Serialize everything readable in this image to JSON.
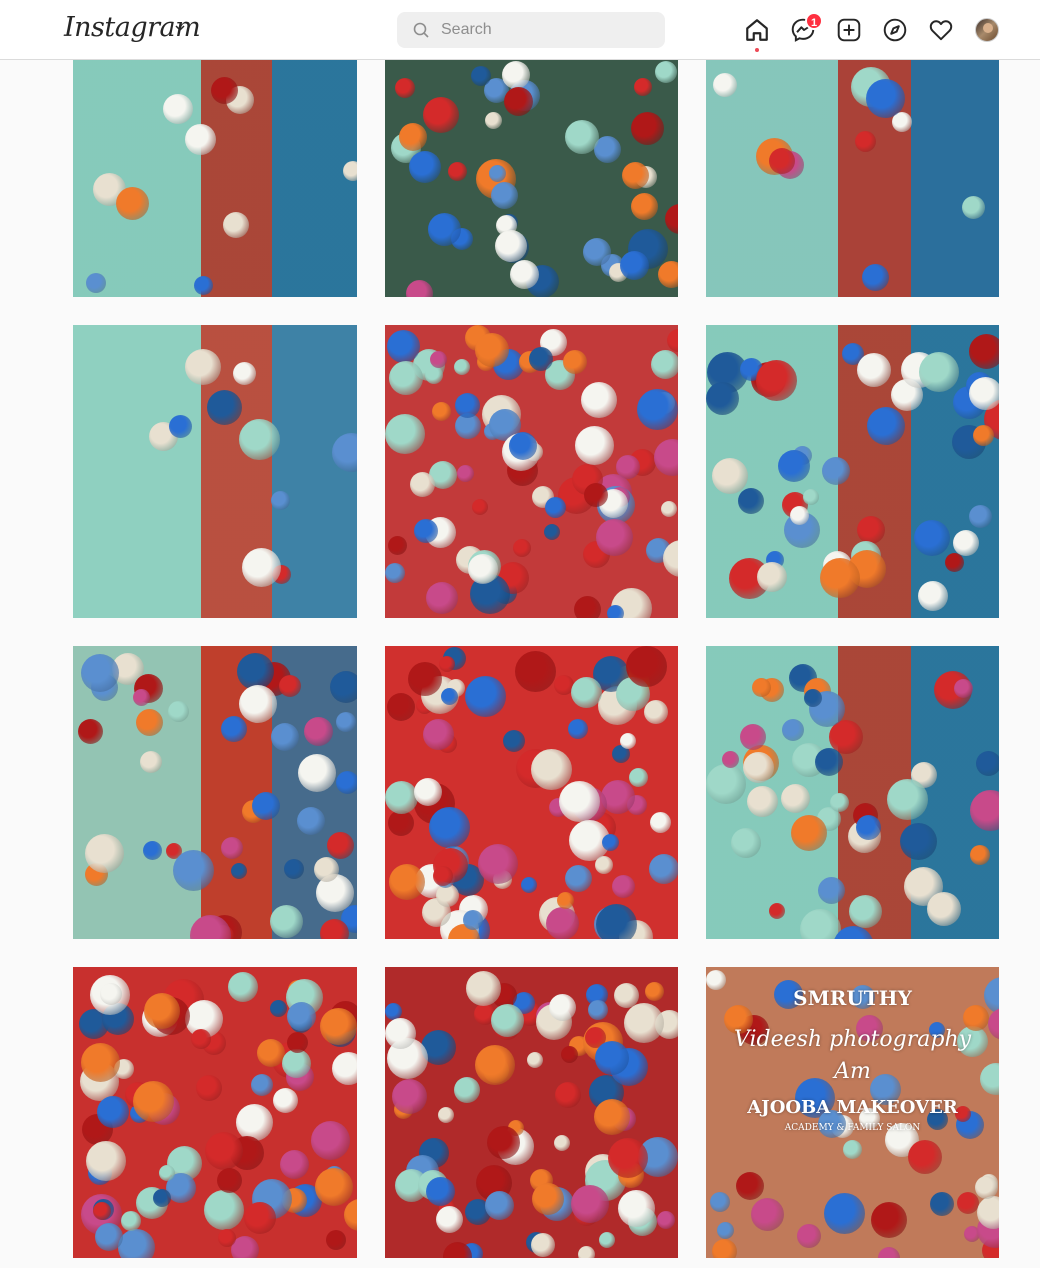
{
  "app": {
    "logo": "Instagram"
  },
  "search": {
    "placeholder": "Search",
    "value": ""
  },
  "nav": {
    "messenger_badge": "1",
    "icons": [
      "home-icon",
      "messenger-icon",
      "new-post-icon",
      "explore-icon",
      "activity-icon",
      "profile-avatar"
    ]
  },
  "colors": {
    "accent": "#ed4956",
    "badge": "#ff3040",
    "topbar_bg": "#ffffff",
    "page_bg": "#fafafa"
  },
  "grid": {
    "tiles": [
      {
        "id": "tile-1",
        "alt": "",
        "bg": "#2f8f8a"
      },
      {
        "id": "tile-2",
        "alt": "",
        "bg": "#3a5a4a"
      },
      {
        "id": "tile-3",
        "alt": "",
        "bg": "#2f6f8a"
      },
      {
        "id": "tile-4",
        "alt": "",
        "bg": "#8fd0c0"
      },
      {
        "id": "tile-5",
        "alt": "",
        "bg": "#c23a3a"
      },
      {
        "id": "tile-6",
        "alt": "",
        "bg": "#2f8f8a"
      },
      {
        "id": "tile-7",
        "alt": "",
        "bg": "#b85a3a"
      },
      {
        "id": "tile-8",
        "alt": "",
        "bg": "#d0302e"
      },
      {
        "id": "tile-9",
        "alt": "",
        "bg": "#2f8f8a"
      },
      {
        "id": "tile-10",
        "alt": "",
        "bg": "#c8302e"
      },
      {
        "id": "tile-11",
        "alt": "",
        "bg": "#b02a2a"
      },
      {
        "id": "tile-12",
        "alt": "",
        "bg": "#c07a5a"
      }
    ]
  },
  "watermark": {
    "line1": "SMRUTHY",
    "line2": "Videesh photography",
    "line3": "Am",
    "line4": "AJOOBA MAKEOVER",
    "line5": "ACADEMY & FAMILY SALON"
  }
}
